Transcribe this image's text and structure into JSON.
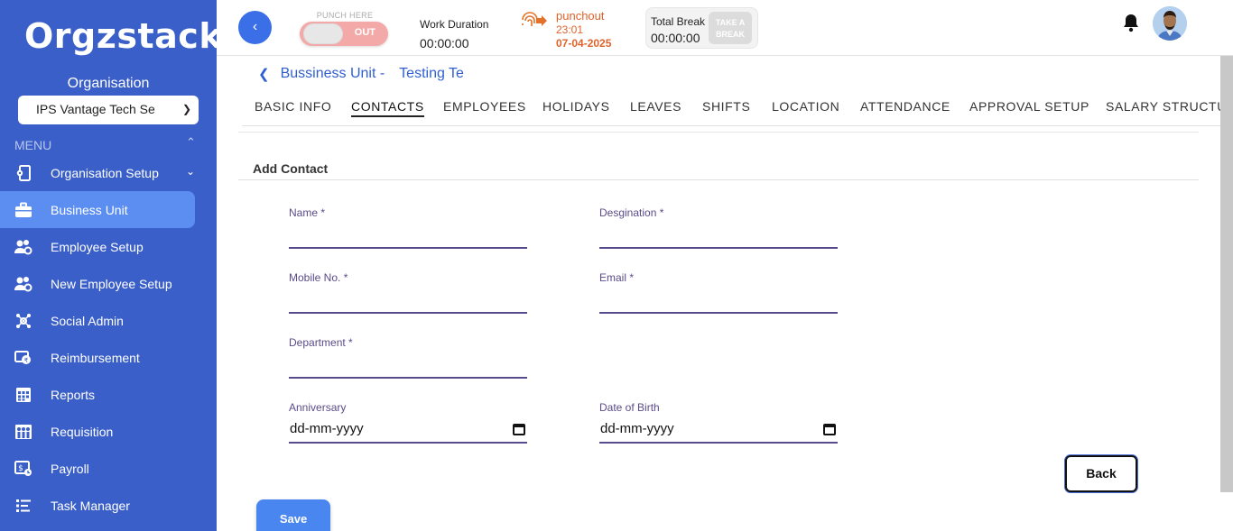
{
  "app": {
    "logo_text": "Orgzstack"
  },
  "sidebar": {
    "org_label": "Organisation",
    "org_selected": "IPS Vantage Tech Se",
    "menu_label": "MENU",
    "items": [
      {
        "label": "Organisation Setup",
        "icon": "org-setup-icon",
        "active": false,
        "expandable": true
      },
      {
        "label": "Business Unit",
        "icon": "briefcase-icon",
        "active": true,
        "expandable": false
      },
      {
        "label": "Employee Setup",
        "icon": "users-gear-icon",
        "active": false,
        "expandable": false
      },
      {
        "label": "New Employee Setup",
        "icon": "users-gear-icon",
        "active": false,
        "expandable": false
      },
      {
        "label": "Social Admin",
        "icon": "social-icon",
        "active": false,
        "expandable": false
      },
      {
        "label": "Reimbursement",
        "icon": "reimbursement-icon",
        "active": false,
        "expandable": false
      },
      {
        "label": "Reports",
        "icon": "calendar-grid-icon",
        "active": false,
        "expandable": false
      },
      {
        "label": "Requisition",
        "icon": "requisition-icon",
        "active": false,
        "expandable": false
      },
      {
        "label": "Payroll",
        "icon": "payroll-icon",
        "active": false,
        "expandable": false
      },
      {
        "label": "Task Manager",
        "icon": "task-list-icon",
        "active": false,
        "expandable": false
      }
    ]
  },
  "topbar": {
    "punch_label": "PUNCH HERE",
    "punch_state": "OUT",
    "work_duration_label": "Work Duration",
    "work_duration_value": "00:00:00",
    "punchout_label": "punchout",
    "punchout_time": "23:01",
    "punchout_date": "07-04-2025",
    "total_break_label": "Total Break",
    "total_break_value": "00:00:00",
    "take_break_line1": "TAKE A",
    "take_break_line2": "BREAK"
  },
  "breadcrumb": {
    "parent": "Bussiness Unit -",
    "current": "Testing Te"
  },
  "tabs": [
    {
      "label": "BASIC INFO",
      "active": false
    },
    {
      "label": "CONTACTS",
      "active": true
    },
    {
      "label": "EMPLOYEES",
      "active": false
    },
    {
      "label": "HOLIDAYS",
      "active": false
    },
    {
      "label": "LEAVES",
      "active": false
    },
    {
      "label": "SHIFTS",
      "active": false
    },
    {
      "label": "LOCATION",
      "active": false
    },
    {
      "label": "ATTENDANCE",
      "active": false
    },
    {
      "label": "APPROVAL SETUP",
      "active": false
    },
    {
      "label": "SALARY STRUCTURE",
      "active": false
    }
  ],
  "form": {
    "title": "Add Contact",
    "fields": {
      "name": {
        "label": "Name *",
        "value": ""
      },
      "designation": {
        "label": "Desgination *",
        "value": ""
      },
      "mobile": {
        "label": "Mobile No. *",
        "value": ""
      },
      "email": {
        "label": "Email *",
        "value": ""
      },
      "department": {
        "label": "Department *",
        "value": ""
      },
      "anniversary": {
        "label": "Anniversary",
        "value": "dd-mm-yyyy"
      },
      "dob": {
        "label": "Date of Birth",
        "value": "dd-mm-yyyy"
      }
    },
    "back_label": "Back",
    "save_label": "Save"
  },
  "colors": {
    "sidebar_bg": "#3a5fc8",
    "active_item": "#5c8ef2",
    "accent_blue": "#2f5fcf",
    "punchout_orange": "#e0622a",
    "field_underline": "#5a4a8e"
  }
}
